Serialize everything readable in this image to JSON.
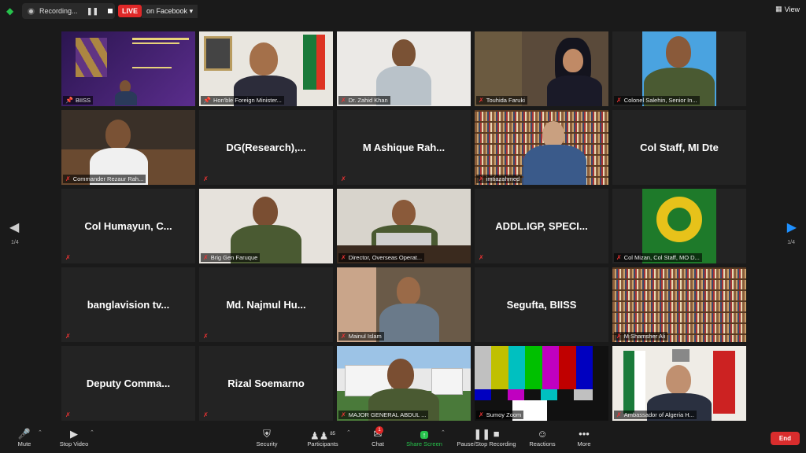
{
  "topbar": {
    "recording_label": "Recording...",
    "live_badge": "LIVE",
    "live_destination": "on Facebook",
    "view_label": "View"
  },
  "navigation": {
    "page_left": "1/4",
    "page_right": "1/4"
  },
  "tiles": [
    {
      "name": "BIISS",
      "type": "video"
    },
    {
      "name": "Hon'ble Foreign Minister...",
      "type": "video"
    },
    {
      "name": "Dr. Zahid Khan",
      "type": "video"
    },
    {
      "name": "Touhida Faruki",
      "type": "video"
    },
    {
      "name": "Colonel Salehin, Senior In...",
      "type": "video"
    },
    {
      "name": "Commander Rezaur Rah...",
      "type": "video"
    },
    {
      "name": "DG(Research),...",
      "type": "name"
    },
    {
      "name": "M Ashique Rah...",
      "type": "name"
    },
    {
      "name": "imtiazahmed",
      "type": "video"
    },
    {
      "name": "Col Staff, MI Dte",
      "type": "name"
    },
    {
      "name": "Col Humayun, C...",
      "type": "name"
    },
    {
      "name": "Brig Gen Faruque",
      "type": "video"
    },
    {
      "name": "Director, Overseas Operat...",
      "type": "video"
    },
    {
      "name": "ADDL.IGP, SPECI...",
      "type": "name"
    },
    {
      "name": "Col Mizan, Col Staff, MO D...",
      "type": "video"
    },
    {
      "name": "banglavision tv...",
      "type": "name"
    },
    {
      "name": "Md. Najmul Hu...",
      "type": "name"
    },
    {
      "name": "Mainul Islam",
      "type": "video"
    },
    {
      "name": "Segufta, BIISS",
      "type": "name"
    },
    {
      "name": "M Shamsher Ali",
      "type": "video"
    },
    {
      "name": "Deputy Comma...",
      "type": "name"
    },
    {
      "name": "Rizal Soemarno",
      "type": "name"
    },
    {
      "name": "MAJOR GENERAL ABDUL ...",
      "type": "video"
    },
    {
      "name": "Sumoy Zoom",
      "type": "video"
    },
    {
      "name": "Ambassador of Algeria H...",
      "type": "video"
    }
  ],
  "toolbar": {
    "mute": "Mute",
    "stop_video": "Stop Video",
    "security": "Security",
    "participants": "Participants",
    "participants_count": "85",
    "chat": "Chat",
    "chat_badge": "1",
    "share_screen": "Share Screen",
    "pause_stop_recording": "Pause/Stop Recording",
    "reactions": "Reactions",
    "more": "More",
    "end": "End"
  },
  "colors": {
    "active_speaker_border": "#c8d400",
    "live_red": "#e02828",
    "share_green": "#27c24c",
    "next_arrow": "#1e90ff"
  }
}
